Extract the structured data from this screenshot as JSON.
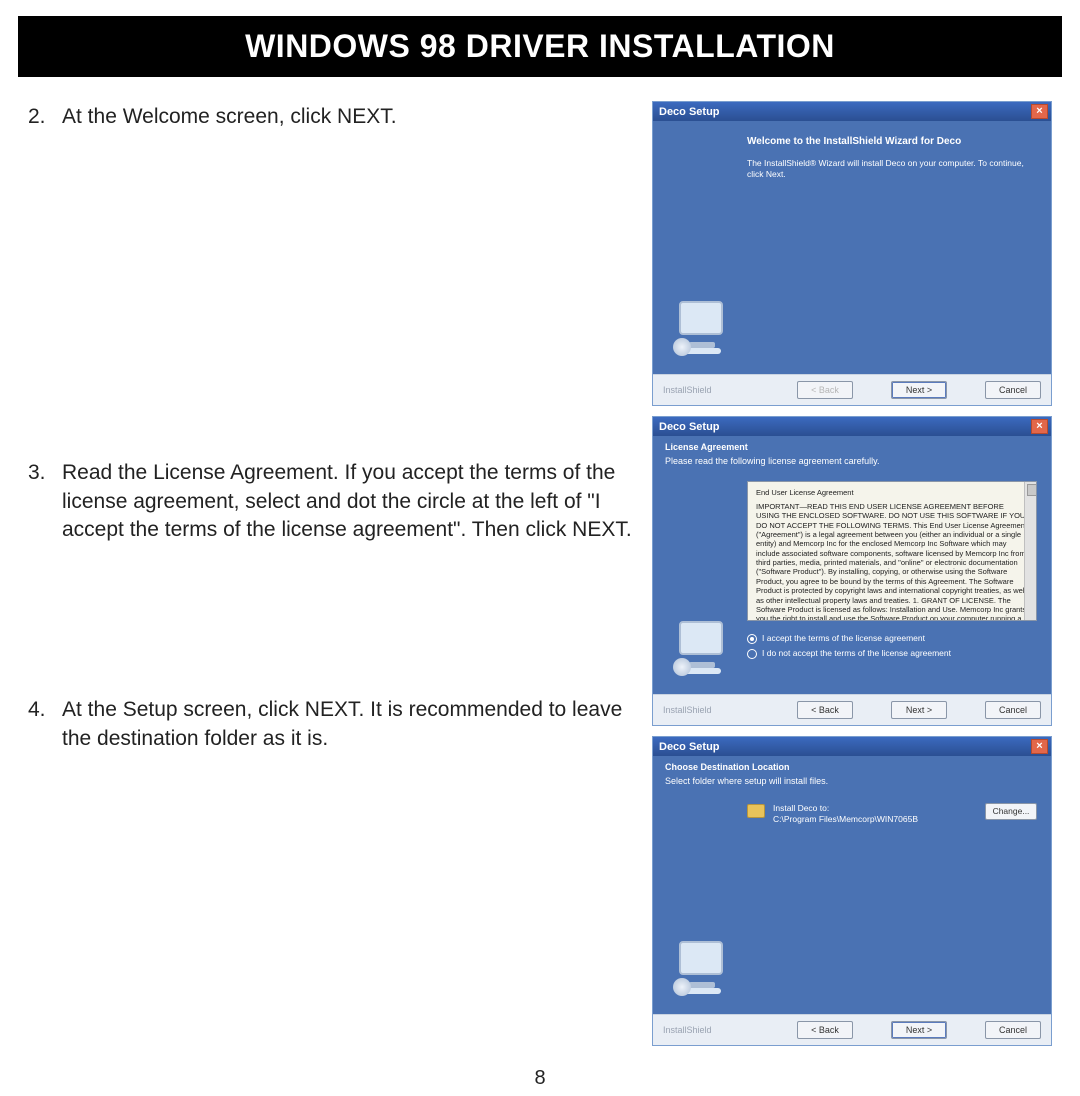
{
  "header": {
    "title": "WINDOWS 98 DRIVER INSTALLATION"
  },
  "steps": [
    {
      "num": "2.",
      "text": "At the Welcome screen, click NEXT."
    },
    {
      "num": "3.",
      "text": "Read the License Agreement. If you accept the terms of the license agreement, select and dot the circle at the left of \"I accept the terms of the license agreement\". Then click NEXT."
    },
    {
      "num": "4.",
      "text": "At the Setup screen, click NEXT. It is recommended to leave the destination folder as it is."
    }
  ],
  "page_number": "8",
  "win1": {
    "title": "Deco Setup",
    "welcome_title": "Welcome to the InstallShield Wizard for Deco",
    "welcome_body": "The InstallShield® Wizard will install Deco on your computer. To continue, click Next.",
    "footer_brand": "InstallShield",
    "btn_back": "< Back",
    "btn_next": "Next >",
    "btn_cancel": "Cancel"
  },
  "win2": {
    "title": "Deco Setup",
    "sub_title": "License Agreement",
    "sub_desc": "Please read the following license agreement carefully.",
    "license_heading": "End User License Agreement",
    "license_body": "IMPORTANT—READ THIS END USER LICENSE AGREEMENT BEFORE USING THE ENCLOSED SOFTWARE. DO NOT USE THIS SOFTWARE IF YOU DO NOT ACCEPT THE FOLLOWING TERMS. This End User License Agreement (\"Agreement\") is a legal agreement between you (either an individual or a single entity) and Memcorp Inc for the enclosed Memcorp Inc Software which may include associated software components, software licensed by Memcorp Inc from third parties, media, printed materials, and \"online\" or electronic documentation (\"Software Product\"). By installing, copying, or otherwise using the Software Product, you agree to be bound by the terms of this Agreement. The Software Product is protected by copyright laws and international copyright treaties, as well as other intellectual property laws and treaties. 1. GRANT OF LICENSE. The Software Product is licensed as follows: Installation and Use. Memcorp Inc grants you the right to install and use the Software Product on your computer running a validly licensed copy of the operating system for which the Software Product was designed (e.g.",
    "radio_accept": "I accept the terms of the license agreement",
    "radio_reject": "I do not accept the terms of the license agreement",
    "btn_back": "< Back",
    "btn_next": "Next >",
    "btn_cancel": "Cancel"
  },
  "win3": {
    "title": "Deco Setup",
    "sub_title": "Choose Destination Location",
    "sub_desc": "Select folder where setup will install files.",
    "dest_label": "Install Deco to:",
    "dest_path": "C:\\Program Files\\Memcorp\\WIN7065B",
    "btn_change": "Change...",
    "btn_back": "< Back",
    "btn_next": "Next >",
    "btn_cancel": "Cancel"
  }
}
